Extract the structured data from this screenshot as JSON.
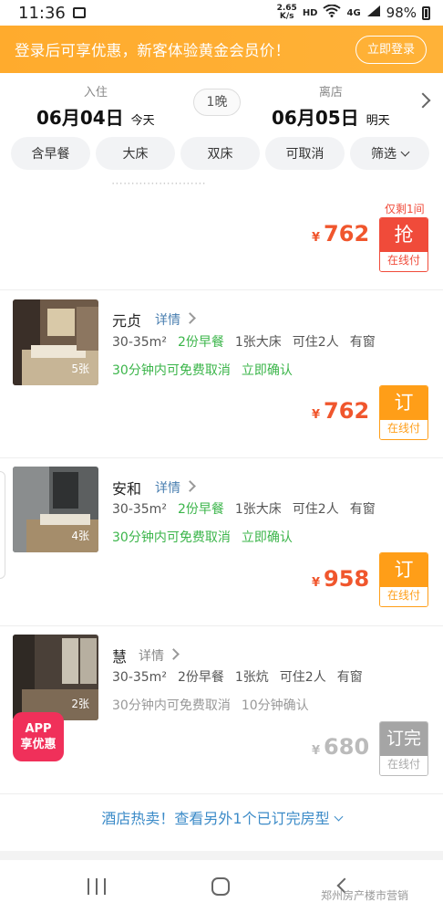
{
  "status_bar": {
    "time": "11:36",
    "speed_value": "2.65",
    "speed_unit": "K/s",
    "hd": "HD",
    "network": "4G",
    "battery": "98%"
  },
  "promo": {
    "text": "登录后可享优惠，新客体验黄金会员价！",
    "login_button": "立即登录"
  },
  "dates": {
    "checkin_label": "入住",
    "checkin_date": "06月04日",
    "checkin_day": "今天",
    "nights": "1晚",
    "checkout_label": "离店",
    "checkout_date": "06月05日",
    "checkout_day": "明天"
  },
  "filters": [
    "含早餐",
    "大床",
    "双床",
    "可取消",
    "筛选"
  ],
  "partial_room": {
    "remaining": "仅剩1间",
    "currency": "¥",
    "price": "762",
    "book_label": "抢",
    "book_sub": "在线付"
  },
  "rooms": [
    {
      "name": "元贞",
      "detail": "详情",
      "photo_count": "5张",
      "area": "30-35m²",
      "breakfast": "2份早餐",
      "bed": "1张大床",
      "occupancy": "可住2人",
      "window": "有窗",
      "cancel": "30分钟内可免费取消",
      "confirm": "立即确认",
      "currency": "¥",
      "price": "762",
      "book_label": "订",
      "book_sub": "在线付"
    },
    {
      "name": "安和",
      "detail": "详情",
      "photo_count": "4张",
      "area": "30-35m²",
      "breakfast": "2份早餐",
      "bed": "1张大床",
      "occupancy": "可住2人",
      "window": "有窗",
      "cancel": "30分钟内可免费取消",
      "confirm": "立即确认",
      "currency": "¥",
      "price": "958",
      "book_label": "订",
      "book_sub": "在线付"
    },
    {
      "name": "慧",
      "detail": "详情",
      "photo_count": "2张",
      "area": "30-35m²",
      "breakfast": "2份早餐",
      "bed": "1张炕",
      "occupancy": "可住2人",
      "window": "有窗",
      "cancel": "30分钟内可免费取消",
      "confirm": "10分钟确认",
      "currency": "¥",
      "price": "680",
      "book_label": "订完",
      "book_sub": "在线付",
      "app_badge_line1": "APP",
      "app_badge_line2": "享优惠"
    }
  ],
  "more_rooms": "酒店热卖！查看另外1个已订完房型",
  "watermark": "郑州房产楼市营销",
  "colors": {
    "promo_bg": "#ffab2d",
    "price": "#f0562d",
    "book_orange": "#ff9e18",
    "book_red": "#f04b3a",
    "green": "#3bb54a",
    "link_blue": "#3c8bc8"
  }
}
